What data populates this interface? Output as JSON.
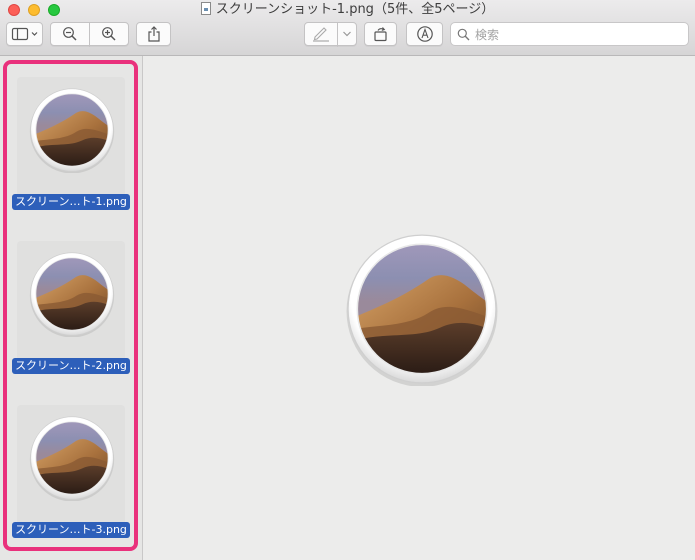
{
  "window": {
    "title": "スクリーンショット-1.png（5件、全5ページ）"
  },
  "toolbar": {
    "buttons": [
      "sidebar-toggle",
      "zoom-out",
      "zoom-in",
      "share",
      "markup-pen",
      "rotate",
      "annotate"
    ]
  },
  "search": {
    "placeholder": "検索",
    "value": ""
  },
  "sidebar": {
    "thumbnails": [
      {
        "label": "スクリーン…ト-1.png",
        "selected": true
      },
      {
        "label": "スクリーン…ト-2.png",
        "selected": true
      },
      {
        "label": "スクリーン…ト-3.png",
        "selected": true
      }
    ]
  },
  "colors": {
    "selection": "#2d5fba",
    "highlight": "#e9317c"
  }
}
